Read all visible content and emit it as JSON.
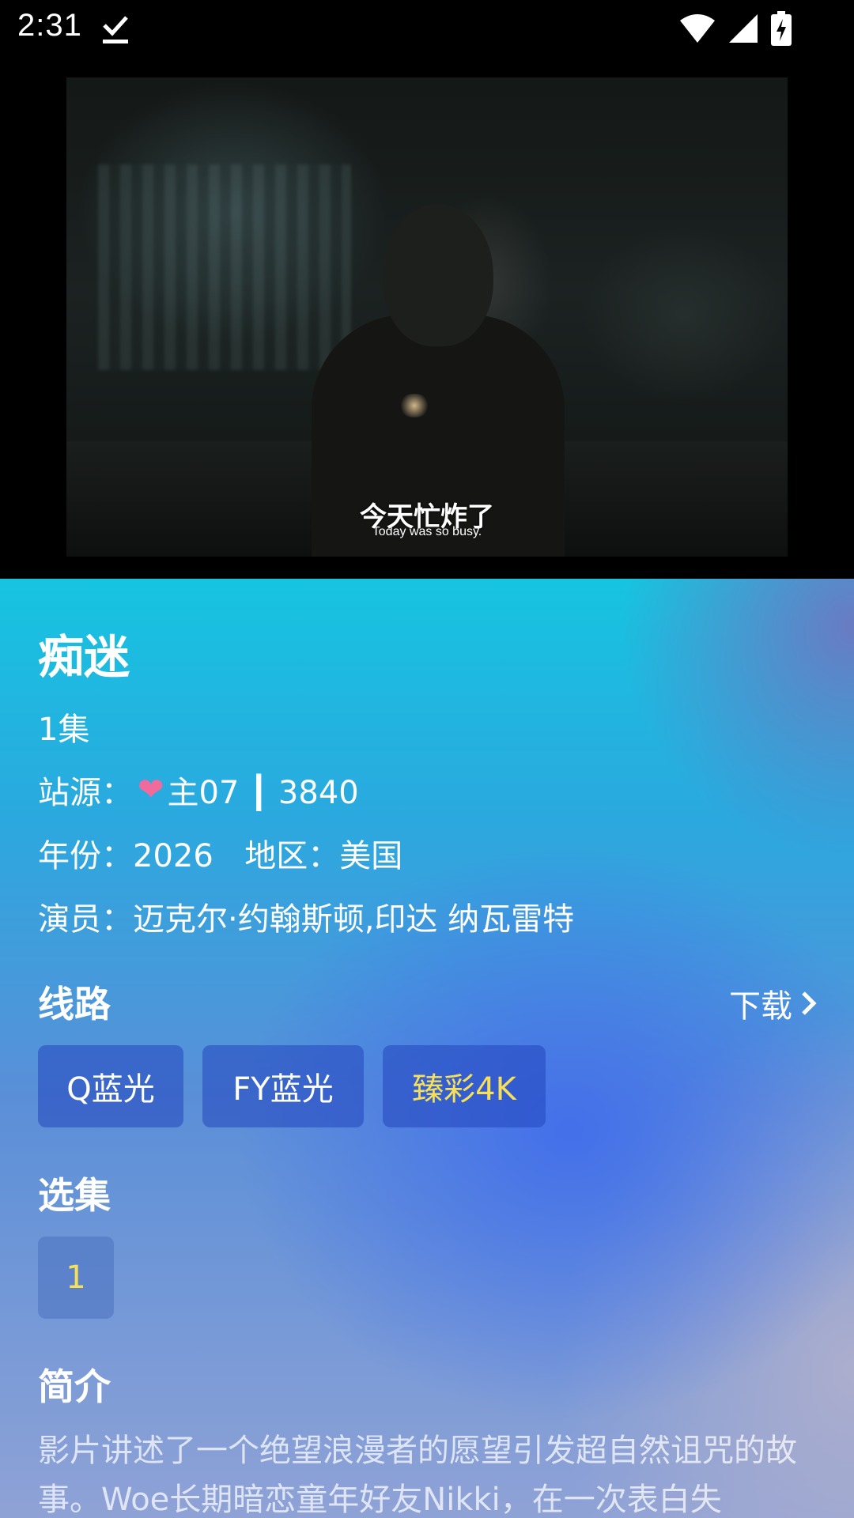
{
  "status_bar": {
    "time": "2:31",
    "icons": [
      "download-done-icon",
      "wifi-icon",
      "signal-icon",
      "battery-charging-icon"
    ]
  },
  "video": {
    "subtitle_zh": "今天忙炸了",
    "subtitle_en": "Today was so busy."
  },
  "detail": {
    "title": "痴迷",
    "episodes": "1集",
    "source_label": "站源：",
    "source_heart": "❤",
    "source_value": "主07 ┃ 3840",
    "year_label": "年份：",
    "year": "2026",
    "region_label": "地区：",
    "region": "美国",
    "actors_label": "演员：",
    "actors": "迈克尔·约翰斯顿,印达 纳瓦雷特"
  },
  "routes": {
    "title": "线路",
    "download_label": "下载",
    "items": [
      {
        "label": "Q蓝光",
        "active": false
      },
      {
        "label": "FY蓝光",
        "active": false
      },
      {
        "label": "臻彩4K",
        "active": true
      }
    ]
  },
  "episodes": {
    "title": "选集",
    "items": [
      "1"
    ]
  },
  "intro": {
    "title": "简介",
    "text": "影片讲述了一个绝望浪漫者的愿望引发超自然诅咒的故事。Woe长期暗恋童年好友Nikki，在一次表白失"
  },
  "colors": {
    "active_chip_text": "#f6e05a",
    "heart": "#f06a9e",
    "top_gradient": "#16c4e0"
  }
}
